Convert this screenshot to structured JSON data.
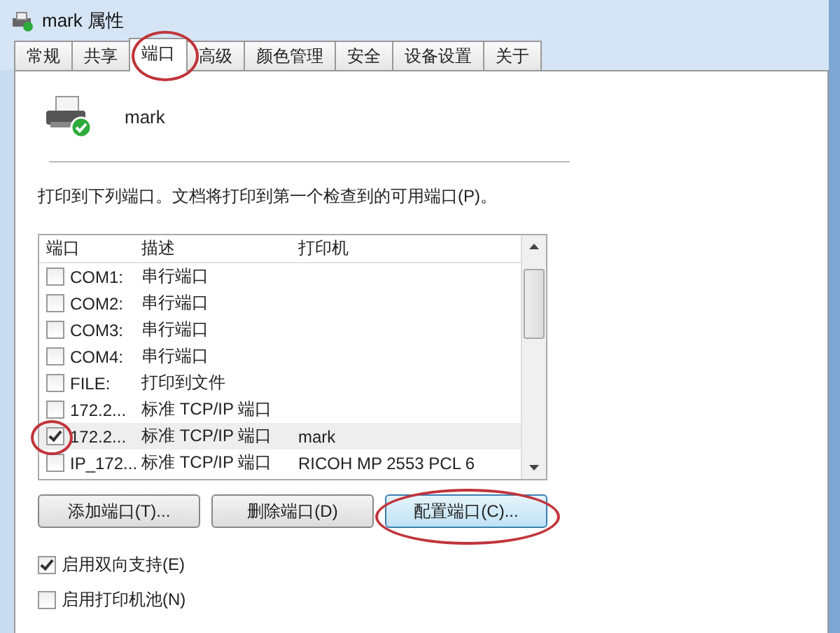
{
  "window": {
    "title": "mark 属性"
  },
  "tabs": [
    {
      "label": "常规",
      "selected": false
    },
    {
      "label": "共享",
      "selected": false
    },
    {
      "label": "端口",
      "selected": true
    },
    {
      "label": "高级",
      "selected": false
    },
    {
      "label": "颜色管理",
      "selected": false
    },
    {
      "label": "安全",
      "selected": false
    },
    {
      "label": "设备设置",
      "selected": false
    },
    {
      "label": "关于",
      "selected": false
    }
  ],
  "printer": {
    "name": "mark"
  },
  "instruction": "打印到下列端口。文档将打印到第一个检查到的可用端口(P)。",
  "port_list": {
    "columns": [
      "端口",
      "描述",
      "打印机"
    ],
    "rows": [
      {
        "port": "COM1:",
        "description": "串行端口",
        "checked": false,
        "selected": false
      },
      {
        "port": "COM2:",
        "description": "串行端口",
        "checked": false,
        "selected": false
      },
      {
        "port": "COM3:",
        "description": "串行端口",
        "checked": false,
        "selected": false
      },
      {
        "port": "COM4:",
        "description": "串行端口",
        "checked": false,
        "selected": false
      },
      {
        "port": "FILE:",
        "description": "打印到文件",
        "checked": false,
        "selected": false
      },
      {
        "port": "172.2...",
        "description": "标准 TCP/IP 端口",
        "checked": false,
        "selected": false
      },
      {
        "port": "172.2...",
        "description": "标准 TCP/IP 端口",
        "printer": "mark",
        "checked": true,
        "selected": true
      },
      {
        "port": "IP_172...",
        "description": "标准 TCP/IP 端口",
        "printer": "RICOH MP 2553 PCL 6",
        "checked": false,
        "selected": false
      }
    ]
  },
  "buttons": [
    {
      "label": "添加端口(T)...",
      "focused": false
    },
    {
      "label": "删除端口(D)",
      "focused": false
    },
    {
      "label": "配置端口(C)...",
      "focused": true
    }
  ],
  "options": [
    {
      "label": "启用双向支持(E)",
      "checked": true
    },
    {
      "label": "启用打印机池(N)",
      "checked": false
    }
  ]
}
